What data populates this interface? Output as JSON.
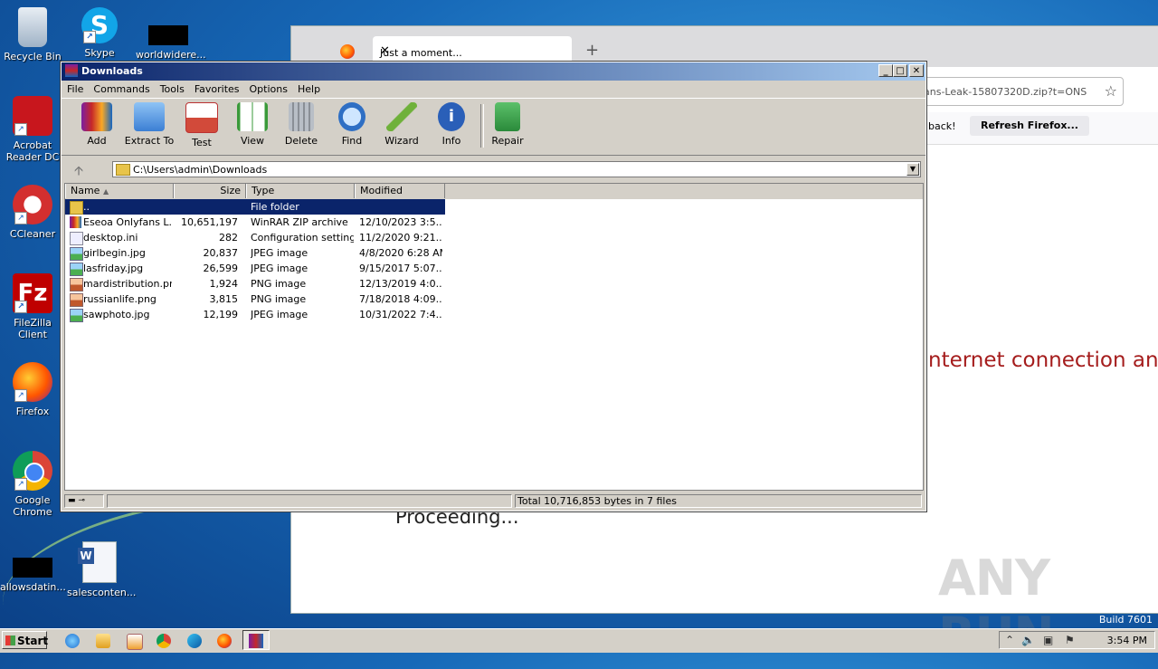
{
  "desktop": {
    "icons": [
      {
        "label": "Recycle Bin"
      },
      {
        "label": "Skype"
      },
      {
        "label": "worldwidere..."
      },
      {
        "label": "Acrobat Reader DC"
      },
      {
        "label": "CCleaner"
      },
      {
        "label": "FileZilla Client"
      },
      {
        "label": "Firefox"
      },
      {
        "label": "Google Chrome"
      },
      {
        "label": "allowsdatin..."
      },
      {
        "label": "salesconten..."
      }
    ],
    "build": "Build 7601"
  },
  "firefox": {
    "tab_title": "Just a moment...",
    "tab_close": "✕",
    "new_tab": "+",
    "url_fragment": "ans-Leak-15807320D.zip?t=ONS",
    "notification_text": "back!",
    "refresh_button": "Refresh Firefox...",
    "error_text": "nternet connection and",
    "proceeding_text": "Proceeding...",
    "watermark": "ANY RUN"
  },
  "winrar": {
    "title": "Downloads",
    "menu": [
      "File",
      "Commands",
      "Tools",
      "Favorites",
      "Options",
      "Help"
    ],
    "toolbar": [
      {
        "label": "Add",
        "icon": "add-archive-icon",
        "color": "#b33a2a"
      },
      {
        "label": "Extract To",
        "icon": "extract-folder-icon",
        "color": "#3b7fd4"
      },
      {
        "label": "Test",
        "icon": "test-clipboard-icon",
        "color": "#d24a3a"
      },
      {
        "label": "View",
        "icon": "view-book-icon",
        "color": "#3a9a3a"
      },
      {
        "label": "Delete",
        "icon": "trash-icon",
        "color": "#8a8f96"
      },
      {
        "label": "Find",
        "icon": "magnifier-icon",
        "color": "#2f6fc4"
      },
      {
        "label": "Wizard",
        "icon": "wand-icon",
        "color": "#6fb13a"
      },
      {
        "label": "Info",
        "icon": "info-icon",
        "color": "#2a5fb8"
      },
      {
        "label": "Repair",
        "icon": "repair-icon",
        "color": "#3a9a4a"
      }
    ],
    "path": "C:\\Users\\admin\\Downloads",
    "columns": {
      "name": "Name",
      "size": "Size",
      "type": "Type",
      "modified": "Modified"
    },
    "rows": [
      {
        "name": "..",
        "size": "",
        "type": "File folder",
        "modified": "",
        "selected": true,
        "icon": "folder-up-icon"
      },
      {
        "name": "Eseoa Onlyfans L...",
        "size": "10,651,197",
        "type": "WinRAR ZIP archive",
        "modified": "12/10/2023 3:5...",
        "icon": "zip-archive-icon"
      },
      {
        "name": "desktop.ini",
        "size": "282",
        "type": "Configuration settings",
        "modified": "11/2/2020 9:21...",
        "icon": "settings-file-icon"
      },
      {
        "name": "girlbegin.jpg",
        "size": "20,837",
        "type": "JPEG image",
        "modified": "4/8/2020 6:28 AM",
        "icon": "jpeg-file-icon"
      },
      {
        "name": "lasfriday.jpg",
        "size": "26,599",
        "type": "JPEG image",
        "modified": "9/15/2017 5:07...",
        "icon": "jpeg-file-icon"
      },
      {
        "name": "mardistribution.png",
        "size": "1,924",
        "type": "PNG image",
        "modified": "12/13/2019 4:0...",
        "icon": "png-file-icon"
      },
      {
        "name": "russianlife.png",
        "size": "3,815",
        "type": "PNG image",
        "modified": "7/18/2018 4:09...",
        "icon": "png-file-icon"
      },
      {
        "name": "sawphoto.jpg",
        "size": "12,199",
        "type": "JPEG image",
        "modified": "10/31/2022 7:4...",
        "icon": "jpeg-file-icon"
      }
    ],
    "status_total": "Total 10,716,853 bytes in 7 files"
  },
  "taskbar": {
    "start_label": "Start",
    "clock": "3:54 PM"
  }
}
